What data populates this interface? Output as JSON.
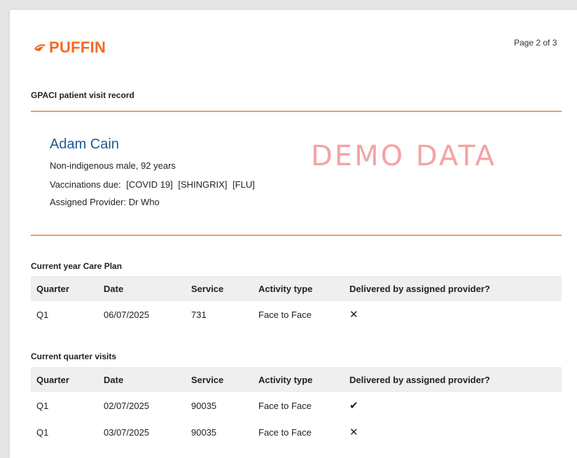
{
  "header": {
    "logo_text": "PUFFIN",
    "page_number": "Page 2 of 3"
  },
  "document": {
    "title": "GPACI patient visit record"
  },
  "patient": {
    "name": "Adam Cain",
    "demographics": "Non-indigenous male, 92 years",
    "vaccinations_label": "Vaccinations due:",
    "vaccinations": [
      "[COVID 19]",
      "[SHINGRIX]",
      "[FLU]"
    ],
    "provider": "Assigned Provider: Dr Who"
  },
  "watermark": "DEMO DATA",
  "care_plan": {
    "title": "Current year Care Plan",
    "columns": [
      "Quarter",
      "Date",
      "Service",
      "Activity type",
      "Delivered by assigned provider?"
    ],
    "rows": [
      {
        "quarter": "Q1",
        "date": "06/07/2025",
        "service": "731",
        "activity": "Face to Face",
        "delivered": "✕"
      }
    ]
  },
  "quarter_visits": {
    "title": "Current quarter visits",
    "columns": [
      "Quarter",
      "Date",
      "Service",
      "Activity type",
      "Delivered by assigned provider?"
    ],
    "rows": [
      {
        "quarter": "Q1",
        "date": "02/07/2025",
        "service": "90035",
        "activity": "Face to Face",
        "delivered": "✔"
      },
      {
        "quarter": "Q1",
        "date": "03/07/2025",
        "service": "90035",
        "activity": "Face to Face",
        "delivered": "✕"
      }
    ]
  },
  "colors": {
    "brand": "#f26a21",
    "rule": "#f39a6a",
    "patient_name": "#1f5a92",
    "watermark": "#f5a3a3",
    "table_header_bg": "#efefef"
  }
}
